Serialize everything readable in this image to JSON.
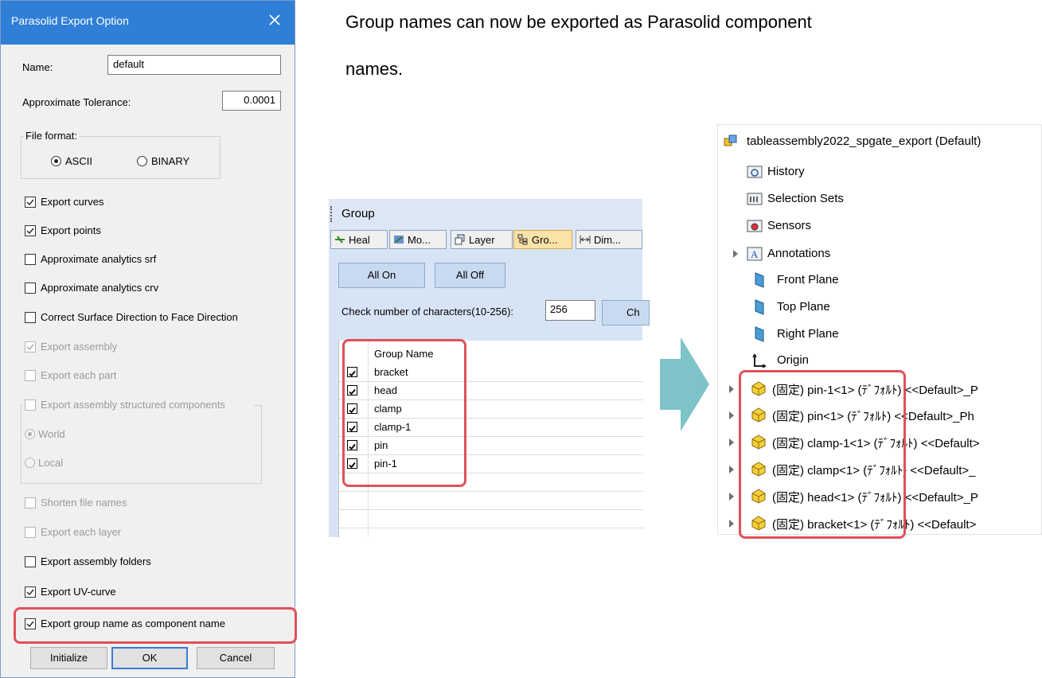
{
  "dialog": {
    "title": "Parasolid Export Option",
    "name_label": "Name:",
    "name_value": "default",
    "tolerance_label": "Approximate Tolerance:",
    "tolerance_value": "0.0001",
    "file_format_label": "File format:",
    "format_options": [
      {
        "label": "ASCII",
        "selected": true
      },
      {
        "label": "BINARY",
        "selected": false
      }
    ],
    "options": [
      {
        "label": "Export curves",
        "checked": true,
        "enabled": true
      },
      {
        "label": "Export points",
        "checked": true,
        "enabled": true
      },
      {
        "label": "Approximate analytics srf",
        "checked": false,
        "enabled": true
      },
      {
        "label": "Approximate analytics crv",
        "checked": false,
        "enabled": true
      },
      {
        "label": "Correct Surface Direction to Face Direction",
        "checked": false,
        "enabled": true
      },
      {
        "label": "Export assembly",
        "checked": true,
        "enabled": false
      },
      {
        "label": "Export each part",
        "checked": false,
        "enabled": false
      }
    ],
    "structured_group": {
      "label": "Export assembly structured components",
      "checked": false,
      "enabled": false,
      "radios": [
        {
          "label": "World",
          "selected": true
        },
        {
          "label": "Local",
          "selected": false
        }
      ]
    },
    "options2": [
      {
        "label": "Shorten file names",
        "checked": false,
        "enabled": false
      },
      {
        "label": "Export each layer",
        "checked": false,
        "enabled": false
      },
      {
        "label": "Export assembly folders",
        "checked": false,
        "enabled": true
      },
      {
        "label": "Export UV-curve",
        "checked": true,
        "enabled": true
      },
      {
        "label": "Export group name as component name",
        "checked": true,
        "enabled": true
      }
    ],
    "buttons": {
      "initialize": "Initialize",
      "ok": "OK",
      "cancel": "Cancel"
    }
  },
  "caption": {
    "line1": "Group names can now be exported as Parasolid component",
    "line2": "names."
  },
  "group_panel": {
    "title": "Group",
    "tabs": [
      "Heal",
      "Mo...",
      "Layer",
      "Gro...",
      "Dim..."
    ],
    "all_on": "All On",
    "all_off": "All Off",
    "check_label": "Check number of characters(10-256):",
    "check_value": "256",
    "check_button": "Ch",
    "column_header": "Group Name",
    "groups": [
      "bracket",
      "head",
      "clamp",
      "clamp-1",
      "pin",
      "pin-1"
    ]
  },
  "tree": {
    "root": "tableassembly2022_spgate_export (Default)",
    "items": [
      "History",
      "Selection Sets",
      "Sensors",
      "Annotations",
      "Front Plane",
      "Top Plane",
      "Right Plane",
      "Origin"
    ],
    "components": [
      "(固定) pin-1<1> (ﾃﾞﾌｫﾙﾄ) <<Default>_P",
      "(固定) pin<1> (ﾃﾞﾌｫﾙﾄ) <<Default>_Ph",
      "(固定) clamp-1<1> (ﾃﾞﾌｫﾙﾄ) <<Default>",
      "(固定) clamp<1> (ﾃﾞﾌｫﾙﾄ) <<Default>_",
      "(固定) head<1> (ﾃﾞﾌｫﾙﾄ) <<Default>_P",
      "(固定) bracket<1> (ﾃﾞﾌｫﾙﾄ) <<Default>"
    ]
  },
  "colors": {
    "highlight": "#e0505a",
    "arrow": "#7ec3c8",
    "title_bar": "#2f7fd7"
  }
}
